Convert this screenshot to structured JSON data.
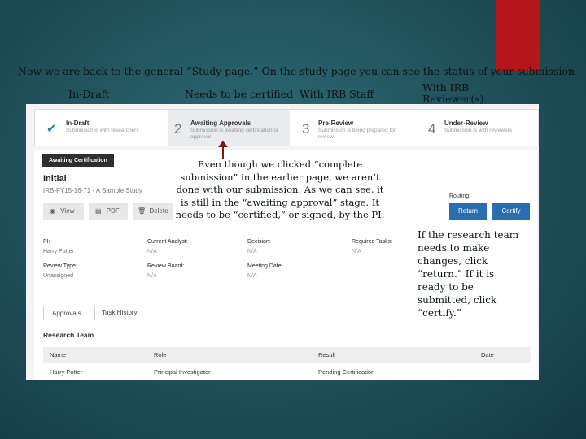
{
  "slide": {
    "intro": "Now we are back to the general “Study page.”  On the study page you can see the status of your submission",
    "stage_labels": [
      "In-Draft",
      "Needs to be certified",
      "With IRB Staff",
      "With IRB Reviewer(s)"
    ],
    "callout": "Even though we clicked “complete submission” in the earlier page, we aren’t done with our submission. As we can see, it is still in the “awaiting approval” stage.  It needs to be “certified,” or signed, by the PI.",
    "side_note": "If the research team needs to make changes, click “return.” If it is ready to be submitted, click “certify.”",
    "accent_color": "#b3161b"
  },
  "app": {
    "steps": [
      {
        "num": "",
        "title": "In-Draft",
        "sub": "Submission is with researchers"
      },
      {
        "num": "2",
        "title": "Awaiting Approvals",
        "sub": "Submission is awaiting certification or approval"
      },
      {
        "num": "3",
        "title": "Pre-Review",
        "sub": "Submission is being prepared for review"
      },
      {
        "num": "4",
        "title": "Under-Review",
        "sub": "Submission is with reviewers"
      }
    ],
    "tag": "Awaiting Certification",
    "initial": "Initial",
    "identifier": "IRB-FY15-16-71 - A Sample Study",
    "toolbar": {
      "view": "View",
      "pdf": "PDF",
      "delete": "Delete"
    },
    "routing": {
      "label": "Routing:",
      "return_label": "Return",
      "certify_label": "Certify"
    },
    "fields": {
      "pi_label": "PI:",
      "pi_value": "Harry Potter",
      "analyst_label": "Current Analyst:",
      "analyst_value": "N/A",
      "decision_label": "Decision:",
      "decision_value": "N/A",
      "tasks_label": "Required Tasks:",
      "tasks_value": "N/A",
      "review_type_label": "Review Type:",
      "review_type_value": "Unassigned",
      "review_board_label": "Review Board:",
      "review_board_value": "N/A",
      "meeting_label": "Meeting Date:",
      "meeting_value": "N/A"
    },
    "tabs": [
      "Approvals",
      "Task History"
    ],
    "research_team_title": "Research Team",
    "table": {
      "headers": [
        "Name",
        "Role",
        "Result",
        "Date"
      ],
      "rows": [
        [
          "Harry Potter",
          "Principal Investigator",
          "Pending Certification",
          ""
        ]
      ]
    },
    "colors": {
      "primary": "#2a6db0",
      "tag_bg": "#2e2e2e"
    },
    "icons": {
      "in_draft": "check-icon"
    }
  }
}
